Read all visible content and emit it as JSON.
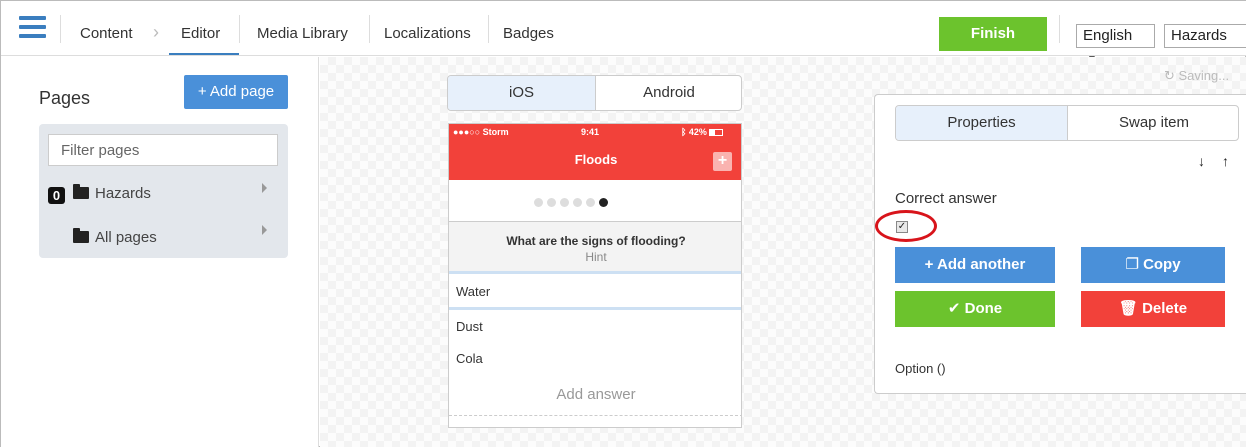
{
  "nav": {
    "breadcrumb_root": "Content",
    "breadcrumb_current": "Editor",
    "tabs": [
      "Media Library",
      "Localizations",
      "Badges"
    ],
    "finish_label": "Finish",
    "language": "English",
    "app_select": "Hazards"
  },
  "pages_panel": {
    "title": "Pages",
    "add_page_label": "+ Add page",
    "filter_placeholder": "Filter pages",
    "tree": [
      {
        "badge": "0",
        "label": "Hazards"
      },
      {
        "label": "All pages"
      }
    ]
  },
  "preview": {
    "platforms": [
      "iOS",
      "Android"
    ],
    "status": {
      "carrier": "●●●○○ Storm",
      "time": "9:41",
      "battery": "42%"
    },
    "screen_title": "Floods",
    "question": "What are the signs of flooding?",
    "hint": "Hint",
    "answers": [
      "Water",
      "Dust",
      "Cola"
    ],
    "add_answer": "Add answer"
  },
  "saving_label": "Saving...",
  "properties": {
    "tabs": [
      "Properties",
      "Swap item"
    ],
    "correct_answer_label": "Correct answer",
    "correct_checked": true,
    "buttons": {
      "add_another": "+ Add another",
      "copy": "Copy",
      "done": "✔ Done",
      "delete": "Delete"
    },
    "option_label": "Option ()"
  },
  "colors": {
    "primary": "#4a90d9",
    "success": "#6cc32d",
    "danger": "#f2413a",
    "annotation": "#d8141b"
  }
}
